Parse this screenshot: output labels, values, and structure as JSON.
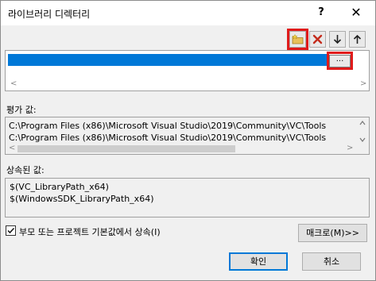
{
  "window": {
    "title": "라이브러리 디렉터리",
    "help_label": "?",
    "close_label": "✕"
  },
  "toolbar": {
    "new_line_icon": "new-folder-icon",
    "delete_icon": "delete-x-icon",
    "move_down_icon": "arrow-down-icon",
    "move_up_icon": "arrow-up-icon"
  },
  "directory_list": {
    "browse_label": "...",
    "scroll_left": "<",
    "scroll_right": ">"
  },
  "evaluated": {
    "label": "평가 값:",
    "lines": [
      "C:\\Program Files (x86)\\Microsoft Visual Studio\\2019\\Community\\VC\\Tools",
      "C:\\Program Files (x86)\\Microsoft Visual Studio\\2019\\Community\\VC\\Tools"
    ],
    "scroll_left": "<",
    "scroll_right": ">"
  },
  "inherited": {
    "label": "상속된 값:",
    "lines": [
      "$(VC_LibraryPath_x64)",
      "$(WindowsSDK_LibraryPath_x64)"
    ]
  },
  "inherit_option": {
    "label": "부모 또는 프로젝트 기본값에서 상속(I)",
    "checked": true
  },
  "buttons": {
    "macro": "매크로(M)>>",
    "ok": "확인",
    "cancel": "취소"
  },
  "colors": {
    "selection": "#0078d7",
    "highlight": "#e01b1b"
  }
}
